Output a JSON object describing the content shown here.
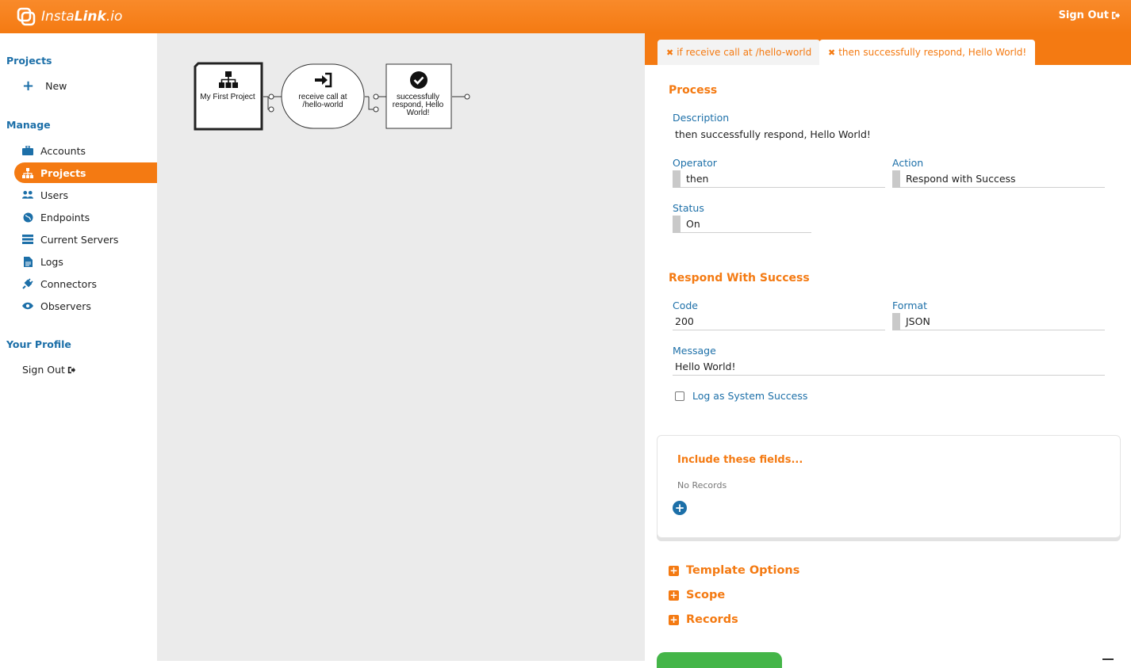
{
  "app": {
    "logo_light": "Insta",
    "logo_bold": "Link",
    "logo_tail": ".io",
    "signout_label": "Sign Out"
  },
  "sidebar": {
    "projects_heading": "Projects",
    "new_label": "New",
    "manage_heading": "Manage",
    "items": [
      {
        "label": "Accounts",
        "icon": "briefcase-icon"
      },
      {
        "label": "Projects",
        "icon": "sitemap-icon",
        "active": true
      },
      {
        "label": "Users",
        "icon": "users-icon"
      },
      {
        "label": "Endpoints",
        "icon": "globe-icon"
      },
      {
        "label": "Current Servers",
        "icon": "server-icon"
      },
      {
        "label": "Logs",
        "icon": "document-icon"
      },
      {
        "label": "Connectors",
        "icon": "plug-icon"
      },
      {
        "label": "Observers",
        "icon": "eye-icon"
      }
    ],
    "profile_heading": "Your Profile",
    "signout_label": "Sign Out"
  },
  "flow": {
    "nodes": [
      {
        "label": "My First Project",
        "icon": "sitemap-icon"
      },
      {
        "label_line1": "receive call at",
        "label_line2": "/hello-world",
        "icon": "sign-in-icon"
      },
      {
        "label_line1": "successfully",
        "label_line2": "respond, Hello",
        "label_line3": "World!",
        "icon": "check-circle-icon"
      }
    ]
  },
  "tabs": [
    {
      "label": "if receive call at /hello-world",
      "active": false
    },
    {
      "label": "then successfully respond, Hello World!",
      "active": true
    }
  ],
  "process": {
    "title": "Process",
    "description_label": "Description",
    "description_value": "then successfully respond, Hello World!",
    "operator_label": "Operator",
    "operator_value": "then",
    "action_label": "Action",
    "action_value": "Respond with Success",
    "status_label": "Status",
    "status_value": "On"
  },
  "respond": {
    "title": "Respond With Success",
    "code_label": "Code",
    "code_value": "200",
    "format_label": "Format",
    "format_value": "JSON",
    "message_label": "Message",
    "message_value": "Hello World!",
    "log_label": "Log as System Success",
    "log_checked": false
  },
  "include": {
    "title": "Include these fields...",
    "empty_text": "No Records"
  },
  "accordions": [
    {
      "label": "Template Options"
    },
    {
      "label": "Scope"
    },
    {
      "label": "Records"
    }
  ],
  "colors": {
    "brand_orange": "#f47a12",
    "link_blue": "#1c6fa8",
    "canvas_gray": "#ebebeb",
    "success_green": "#44b548"
  }
}
